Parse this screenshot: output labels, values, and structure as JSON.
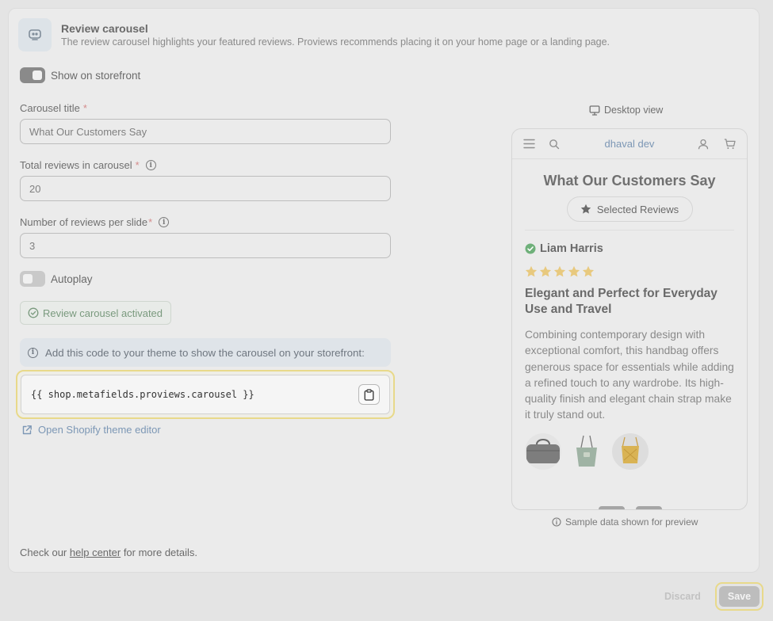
{
  "header": {
    "title": "Review carousel",
    "description": "The review carousel highlights your featured reviews. Proviews recommends placing it on your home page or a landing page."
  },
  "show_on_storefront": {
    "label": "Show on storefront",
    "enabled": true
  },
  "carousel_title": {
    "label": "Carousel title",
    "required_mark": "*",
    "value": "What Our Customers Say"
  },
  "total_reviews": {
    "label": "Total reviews in carousel",
    "required_mark": "*",
    "info": "i",
    "value": "20"
  },
  "reviews_per_slide": {
    "label": "Number of reviews per slide",
    "required_mark": "*",
    "info": "i",
    "value": "3"
  },
  "autoplay": {
    "label": "Autoplay",
    "enabled": false
  },
  "status_badge": "Review carousel activated",
  "code_banner": {
    "info": "i",
    "text": "Add this code to your theme to show the carousel on your storefront:"
  },
  "code_snippet": "{{ shop.metafields.proviews.carousel }}",
  "theme_editor_link": "Open Shopify theme editor",
  "footer": {
    "prefix": "Check our ",
    "link": "help center",
    "suffix": " for more details."
  },
  "preview": {
    "view_mode": "Desktop view",
    "store_name": "dhaval dev",
    "heading": "What Our Customers Say",
    "pill": "Selected Reviews",
    "review": {
      "author": "Liam Harris",
      "rating": 5,
      "title": "Elegant and Perfect for Everyday Use and Travel",
      "body": "Combining contemporary design with exceptional comfort, this handbag offers generous space for essentials while adding a refined touch to any wardrobe. Its high-quality finish and elegant chain strap make it truly stand out."
    },
    "sample_note": "Sample data shown for preview"
  },
  "actions": {
    "discard": "Discard",
    "save": "Save"
  },
  "colors": {
    "accent_link": "#7c97b5",
    "star": "#e8c97e",
    "verified": "#6fb07a",
    "focus_ring": "#e8d98a"
  }
}
